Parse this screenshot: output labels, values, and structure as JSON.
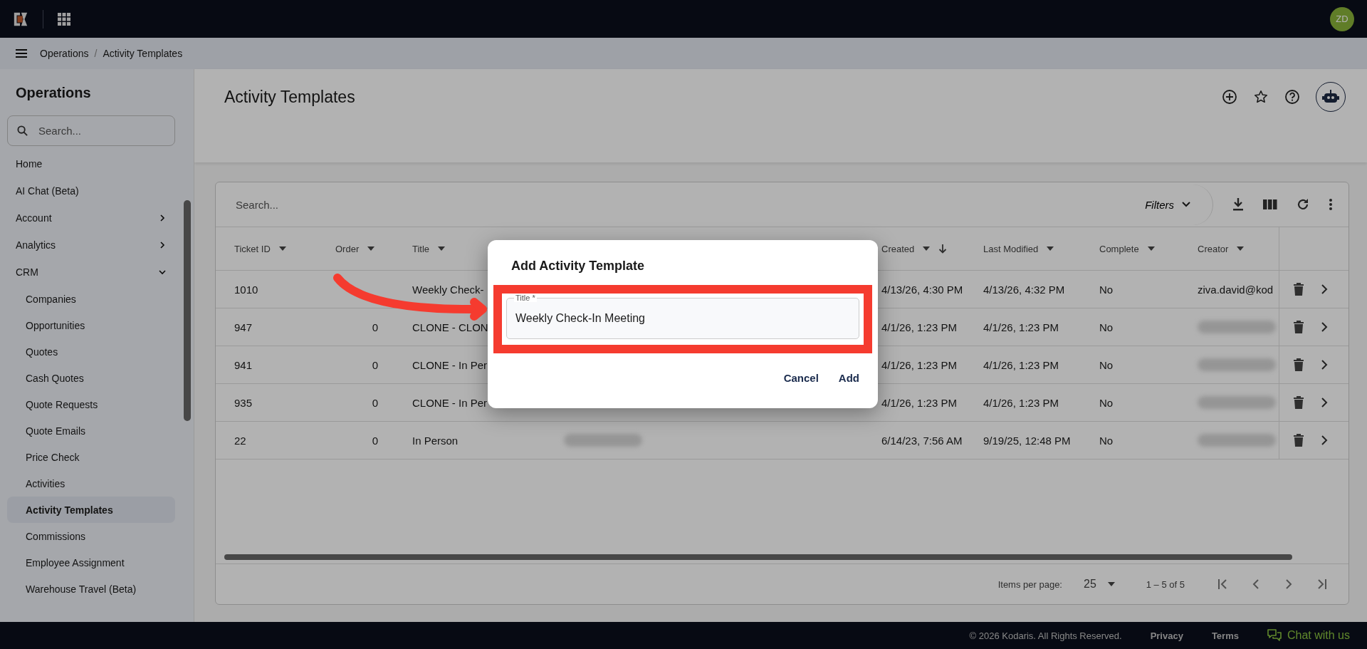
{
  "app": {
    "breadcrumb": [
      "Operations",
      "Activity Templates"
    ],
    "breadcrumb_separator": "/",
    "user_initials": "ZD"
  },
  "sidebar": {
    "title": "Operations",
    "search_placeholder": "Search...",
    "items": [
      {
        "label": "Home",
        "selected": false
      },
      {
        "label": "AI Chat (Beta)",
        "selected": false
      },
      {
        "label": "Account",
        "selected": false,
        "expanded": false
      },
      {
        "label": "Analytics",
        "selected": false,
        "expanded": false
      },
      {
        "label": "CRM",
        "selected": false,
        "expanded": true,
        "children": [
          {
            "label": "Companies",
            "selected": false
          },
          {
            "label": "Opportunities",
            "selected": false
          },
          {
            "label": "Quotes",
            "selected": false
          },
          {
            "label": "Cash Quotes",
            "selected": false
          },
          {
            "label": "Quote Requests",
            "selected": false
          },
          {
            "label": "Quote Emails",
            "selected": false
          },
          {
            "label": "Price Check",
            "selected": false
          },
          {
            "label": "Activities",
            "selected": false
          },
          {
            "label": "Activity Templates",
            "selected": true
          },
          {
            "label": "Commissions",
            "selected": false
          },
          {
            "label": "Employee Assignment",
            "selected": false
          },
          {
            "label": "Warehouse Travel (Beta)",
            "selected": false
          }
        ]
      }
    ]
  },
  "page": {
    "title": "Activity Templates"
  },
  "table": {
    "search_placeholder": "Search...",
    "filters": "Filters",
    "columns": [
      {
        "label": "Ticket ID",
        "sorted": false
      },
      {
        "label": "Order",
        "sorted": false
      },
      {
        "label": "Title",
        "sorted": false
      },
      {
        "label": "Created",
        "sorted": true
      },
      {
        "label": "Last Modified",
        "sorted": false
      },
      {
        "label": "Complete",
        "sorted": false
      },
      {
        "label": "Creator",
        "sorted": false
      }
    ],
    "rows": [
      {
        "ticket_id": "1010",
        "title": "Weekly Check-",
        "created": "4/13/26, 4:30 PM",
        "last_modified": "4/13/26, 4:32 PM",
        "complete": "No",
        "creator": "ziva.david@kod",
        "redacted": false
      },
      {
        "ticket_id": "947",
        "order": "0",
        "title": "CLONE - CLON",
        "created": "4/1/26, 1:23 PM",
        "last_modified": "4/1/26, 1:23 PM",
        "complete": "No",
        "redacted": true
      },
      {
        "ticket_id": "941",
        "order": "0",
        "title": "CLONE - In Per",
        "created": "4/1/26, 1:23 PM",
        "last_modified": "4/1/26, 1:23 PM",
        "complete": "No",
        "redacted": true
      },
      {
        "ticket_id": "935",
        "order": "0",
        "title": "CLONE - In Per",
        "created": "4/1/26, 1:23 PM",
        "last_modified": "4/1/26, 1:23 PM",
        "complete": "No",
        "redacted": true
      },
      {
        "ticket_id": "22",
        "order": "0",
        "title": "In Person",
        "created": "6/14/23, 7:56 AM",
        "last_modified": "9/19/25, 12:48 PM",
        "complete": "No",
        "redacted": true
      }
    ],
    "paginator": {
      "label": "Items per page:",
      "page_size": "25",
      "range": "1 – 5 of 5"
    }
  },
  "footer": {
    "copyright": "© 2026 Kodaris. All Rights Reserved.",
    "links": [
      "Privacy",
      "Terms"
    ],
    "chat": "Chat with us"
  },
  "dialog": {
    "title": "Add Activity Template",
    "field_label": "Title *",
    "field_value": "Weekly Check-In Meeting",
    "buttons": [
      "Cancel",
      "Add"
    ]
  }
}
